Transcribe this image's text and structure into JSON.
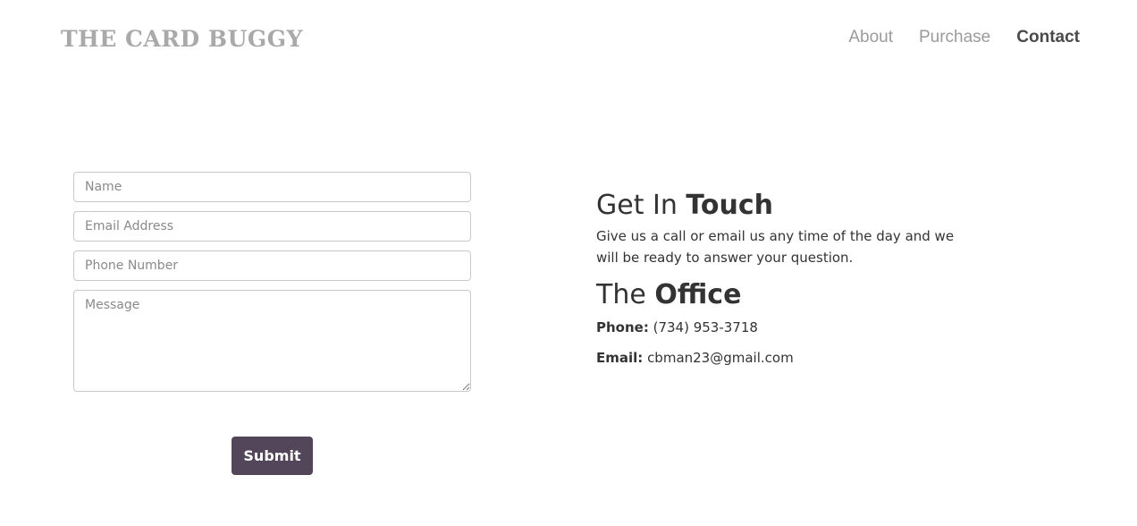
{
  "header": {
    "logo": "THE CARD BUGGY",
    "nav": [
      {
        "label": "About",
        "active": false
      },
      {
        "label": "Purchase",
        "active": false
      },
      {
        "label": "Contact",
        "active": true
      }
    ]
  },
  "form": {
    "name_placeholder": "Name",
    "email_placeholder": "Email Address",
    "phone_placeholder": "Phone Number",
    "message_placeholder": "Message",
    "submit_label": "Submit"
  },
  "contact": {
    "heading_light": "Get In",
    "heading_bold": "Touch",
    "intro": "Give us a call or email us any time of the day and we will be ready to answer your question.",
    "office_light": "The",
    "office_bold": "Office",
    "phone_label": "Phone:",
    "phone_value": "(734) 953-3718",
    "email_label": "Email:",
    "email_value": "cbman23@gmail.com"
  },
  "colors": {
    "accent": "#54465a",
    "logo": "#a9a9a9",
    "nav_inactive": "#9b9b9b",
    "nav_active": "#4a4a4a"
  }
}
